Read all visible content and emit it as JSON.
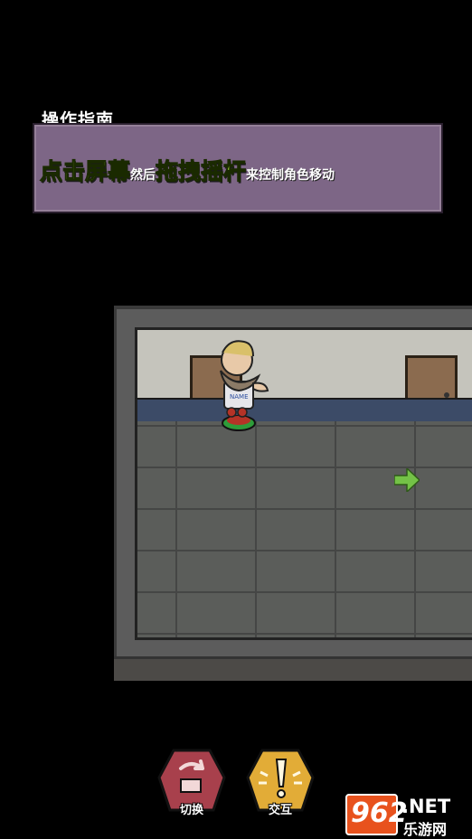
{
  "guide": {
    "title": "操作指南",
    "parts": [
      "点击屏幕",
      "然后",
      "拖拽摇杆",
      "来控制角色移动"
    ]
  },
  "character": {
    "shirt_text": "NAME"
  },
  "controls": {
    "switch_label": "切换",
    "interact_label": "交互"
  },
  "watermark": {
    "number": "962",
    "suffix": ".NET",
    "sub": "乐游网"
  },
  "colors": {
    "guide_box": "#7d6686",
    "highlight_text": "#b8f040",
    "arrow": "#74c247"
  }
}
